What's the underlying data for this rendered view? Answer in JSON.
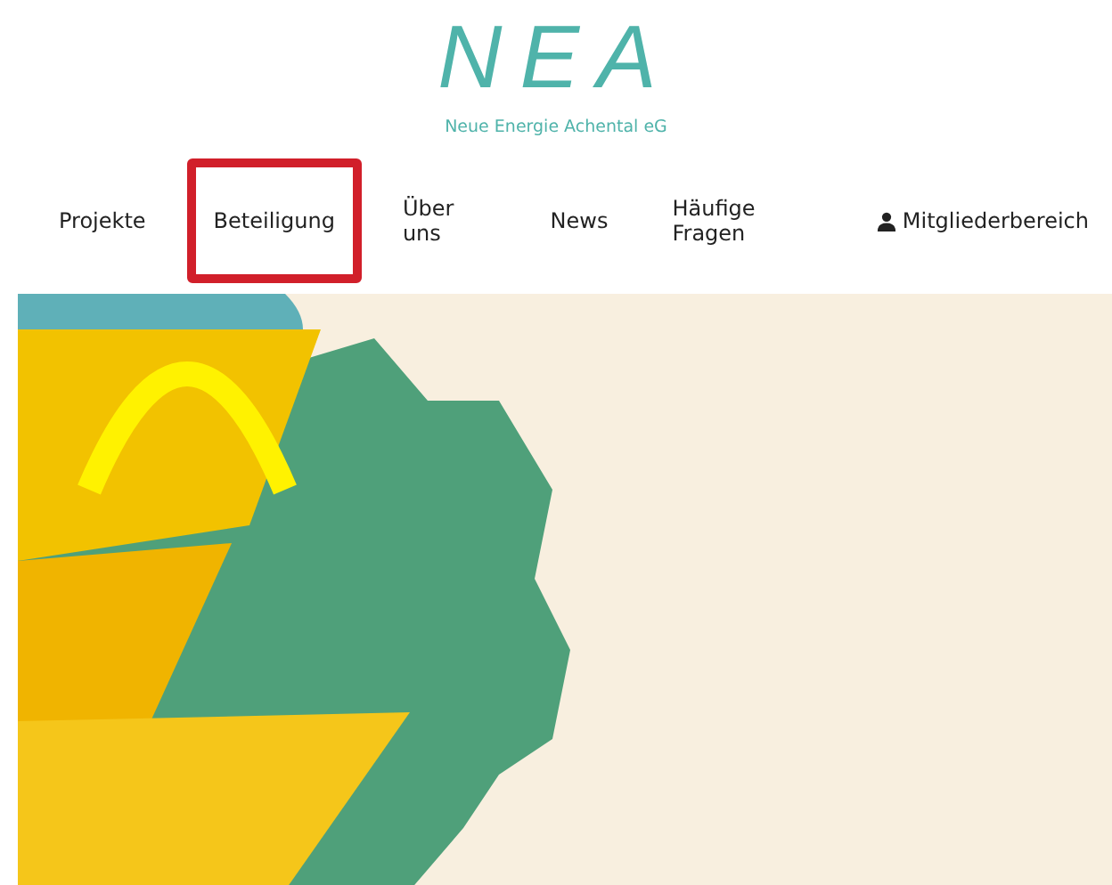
{
  "logo": {
    "mark": "NEA",
    "tagline": "Neue Energie Achental eG"
  },
  "nav": [
    {
      "label": "Projekte",
      "highlighted": false,
      "kind": "link"
    },
    {
      "label": "Beteiligung",
      "highlighted": true,
      "kind": "link"
    },
    {
      "label": "Über uns",
      "highlighted": false,
      "kind": "link"
    },
    {
      "label": "News",
      "highlighted": false,
      "kind": "link"
    },
    {
      "label": "Häufige Fragen",
      "highlighted": false,
      "kind": "link"
    },
    {
      "label": "Mitgliederbereich",
      "highlighted": false,
      "kind": "user"
    }
  ]
}
